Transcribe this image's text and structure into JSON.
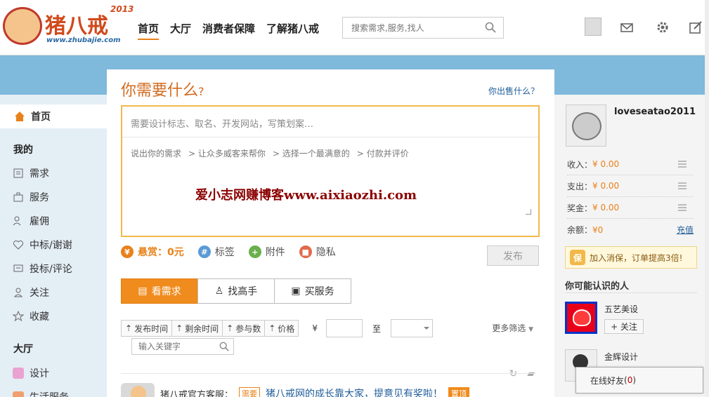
{
  "logo": {
    "name": "猪八戒",
    "year": "2013",
    "url": "www.zhubajie.com"
  },
  "nav": [
    {
      "label": "首页",
      "active": true
    },
    {
      "label": "大厅",
      "active": false
    },
    {
      "label": "消费者保障",
      "active": false
    },
    {
      "label": "了解猪八戒",
      "active": false
    }
  ],
  "search": {
    "placeholder": "搜索需求,服务,找人"
  },
  "sidebar": {
    "home": "首页",
    "mine_heading": "我的",
    "mine_items": [
      "需求",
      "服务",
      "雇佣",
      "中标/谢谢",
      "投标/评论",
      "关注",
      "收藏"
    ],
    "hall_heading": "大厅",
    "hall_items": [
      "设计",
      "生活服务"
    ]
  },
  "main": {
    "title_main": "你需要什么",
    "title_q": "?",
    "sell_link": "你出售什么？",
    "textarea_placeholder": "需要设计标志、取名、开发网站，写策划案…",
    "steps": [
      "说出你的需求",
      "> 让众多威客来帮你",
      "> 选择一个最满意的",
      "> 付款并评价"
    ],
    "watermark": "爱小志网赚博客www.aixiaozhi.com",
    "reward_label": "悬赏：0元",
    "tag_label": "标签",
    "attach_label": "附件",
    "privacy_label": "隐私",
    "publish": "发布",
    "tabs": [
      {
        "label": "看需求",
        "active": true
      },
      {
        "label": "找高手",
        "active": false
      },
      {
        "label": "买服务",
        "active": false
      }
    ],
    "filters": [
      "发布时间",
      "剩余时间",
      "参与数",
      "价格"
    ],
    "yen": "¥",
    "to": "至",
    "more_filter": "更多筛选",
    "keyword_placeholder": "输入关键字",
    "feed": {
      "author": "猪八戒官方客服：",
      "badge": "需要",
      "link": "猪八戒网的成长靠大家，提意见有奖啦！",
      "top": "置顶"
    }
  },
  "user": {
    "name": "loveseatao2011",
    "income_label": "收入：",
    "income": "¥ 0.00",
    "expense_label": "支出：",
    "expense": "¥ 0.00",
    "bonus_label": "奖金：",
    "bonus": "¥ 0.00",
    "balance_label": "余额：",
    "balance": "¥0",
    "charge": "充值"
  },
  "promo": {
    "badge": "保",
    "text": "加入消保，订单提高3倍!"
  },
  "maybe": {
    "title": "你可能认识的人",
    "people": [
      {
        "name": "五艺美设",
        "follow": "+ 关注"
      },
      {
        "name": "金辉设计"
      }
    ]
  },
  "online": {
    "label": "在线好友",
    "open": "(",
    "count": "0",
    "close": ")"
  }
}
